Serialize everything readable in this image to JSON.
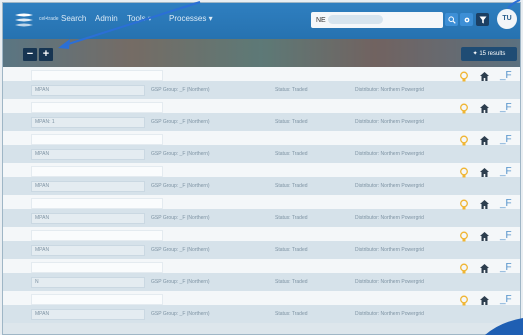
{
  "navbar": {
    "logo_text": "cel•trade",
    "links": [
      "Search",
      "Admin",
      "Tools ▾",
      "Processes ▾"
    ],
    "search_value": "NE",
    "avatar_initials": "TU"
  },
  "controls": {
    "collapse_label": "−",
    "expand_label": "+",
    "results_label": "✦ 15 results"
  },
  "rows": [
    {
      "mpan": "MPAN",
      "gsp": "GSP Group: _F (Northern)",
      "status": "Status: Traded",
      "distributor": "Distributor: Northern Powergrid",
      "link": "_F"
    },
    {
      "mpan": "MPAN: 1",
      "gsp": "GSP Group: _F (Northern)",
      "status": "Status: Traded",
      "distributor": "Distributor: Northern Powergrid",
      "link": "_F"
    },
    {
      "mpan": "MPAN",
      "gsp": "GSP Group: _F (Northern)",
      "status": "Status: Traded",
      "distributor": "Distributor: Northern Powergrid",
      "link": "_F"
    },
    {
      "mpan": "MPAN",
      "gsp": "GSP Group: _F (Northern)",
      "status": "Status: Traded",
      "distributor": "Distributor: Northern Powergrid",
      "link": "_F"
    },
    {
      "mpan": "MPAN",
      "gsp": "GSP Group: _F (Northern)",
      "status": "Status: Traded",
      "distributor": "Distributor: Northern Powergrid",
      "link": "_F"
    },
    {
      "mpan": "MPAN",
      "gsp": "GSP Group: _F (Northern)",
      "status": "Status: Traded",
      "distributor": "Distributor: Northern Powergrid",
      "link": "_F"
    },
    {
      "mpan": "N",
      "gsp": "GSP Group: _F (Northern)",
      "status": "Status: Traded",
      "distributor": "Distributor: Northern Powergrid",
      "link": "_F"
    },
    {
      "mpan": "MPAN",
      "gsp": "GSP Group: _F (Northern)",
      "status": "Status: Traded",
      "distributor": "Distributor: Northern Powergrid",
      "link": "_F"
    }
  ],
  "colors": {
    "navbar": "#2a78b8",
    "accent": "#1f4c74",
    "bulb": "#f0b533",
    "link": "#4f8fc9",
    "annotation": "#2b6fd6"
  }
}
